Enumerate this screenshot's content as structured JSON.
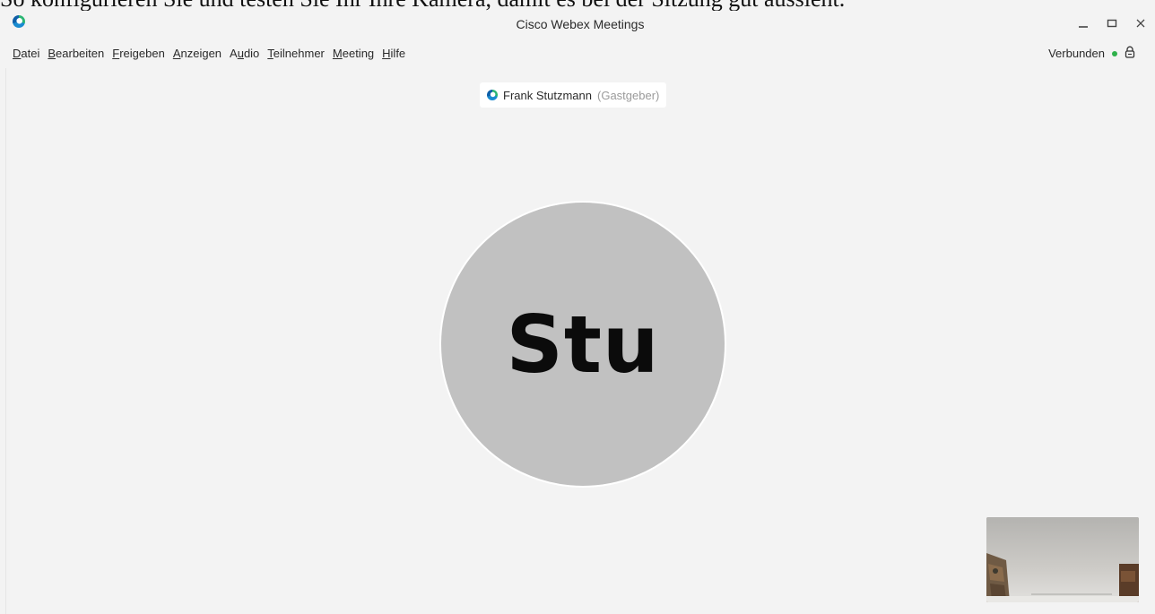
{
  "clipped_banner": "So konfigurieren Sie und testen Sie Ihr Ihre Kamera, damit es bei der Sitzung gut aussieht.",
  "window": {
    "title": "Cisco Webex Meetings",
    "logo_icon": "webex-logo-icon",
    "controls": [
      "minimize-icon",
      "maximize-icon",
      "close-icon"
    ]
  },
  "menu": {
    "items": [
      {
        "mnemonic": "D",
        "rest": "atei"
      },
      {
        "mnemonic": "B",
        "rest": "earbeiten"
      },
      {
        "mnemonic": "F",
        "rest": "reigeben"
      },
      {
        "mnemonic": "A",
        "rest": "nzeigen"
      },
      {
        "pre": "A",
        "mnemonic": "u",
        "rest": "dio"
      },
      {
        "mnemonic": "T",
        "rest": "eilnehmer"
      },
      {
        "mnemonic": "M",
        "rest": "eeting"
      },
      {
        "mnemonic": "H",
        "rest": "ilfe"
      }
    ]
  },
  "status": {
    "connection_text": "Verbunden",
    "dot_color": "#2fb14b",
    "lock_icon": "lock-icon"
  },
  "speaker": {
    "name": "Frank Stutzmann",
    "role": "(Gastgeber)"
  },
  "avatar": {
    "initials": "Stu",
    "color": "#c1c1c1"
  },
  "self_view": {
    "label": "self-video-preview"
  }
}
